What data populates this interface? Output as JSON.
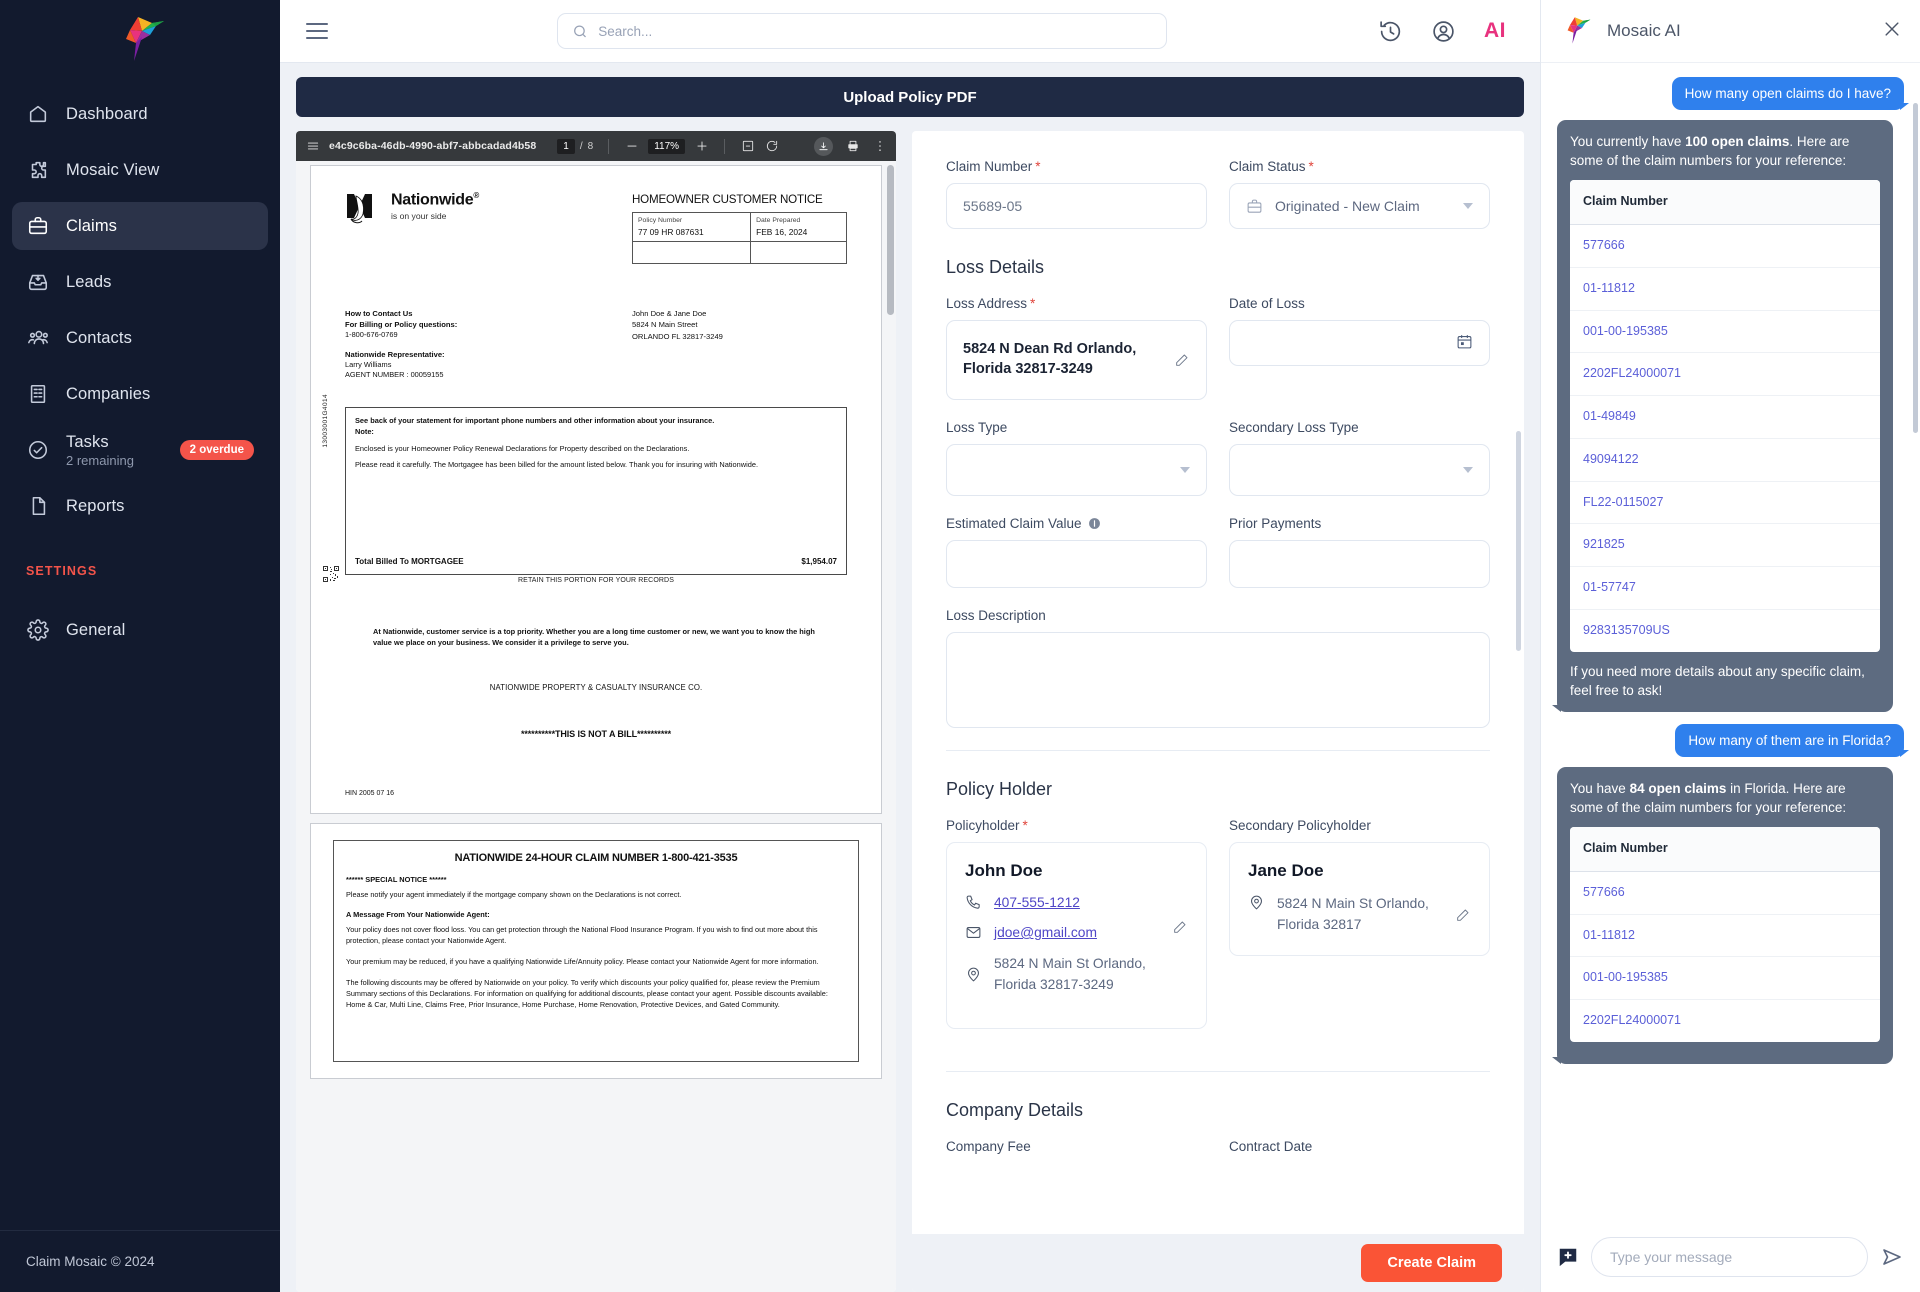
{
  "sidebar": {
    "items": [
      {
        "label": "Dashboard",
        "icon": "home-icon"
      },
      {
        "label": "Mosaic View",
        "icon": "puzzle-icon"
      },
      {
        "label": "Claims",
        "icon": "briefcase-icon",
        "active": true
      },
      {
        "label": "Leads",
        "icon": "inbox-download-icon"
      },
      {
        "label": "Contacts",
        "icon": "users-icon"
      },
      {
        "label": "Companies",
        "icon": "building-icon"
      },
      {
        "label": "Tasks",
        "sub": "2 remaining",
        "badge": "2 overdue",
        "icon": "check-circle-icon"
      },
      {
        "label": "Reports",
        "icon": "document-icon"
      }
    ],
    "settings_heading": "SETTINGS",
    "settings_items": [
      {
        "label": "General",
        "icon": "gear-icon"
      }
    ],
    "footer": "Claim Mosaic © 2024"
  },
  "topbar": {
    "search_placeholder": "Search...",
    "ai_label": "AI",
    "icons": [
      "history-icon",
      "user-circle-icon"
    ]
  },
  "upload_bar": {
    "label": "Upload Policy PDF"
  },
  "pdf": {
    "filename": "e4c9c6ba-46db-4990-abf7-abbcadad4b58",
    "page_current": "1",
    "page_total": "8",
    "zoom": "117%",
    "page1": {
      "brand_name": "Nationwide",
      "brand_reg": "®",
      "brand_tagline": "is on your side",
      "notice_title": "HOMEOWNER CUSTOMER NOTICE",
      "policy_label": "Policy Number",
      "policy_value": "77 09 HR 087631",
      "date_label": "Date Prepared",
      "date_value": "FEB 16, 2024",
      "contact_h1": "How to Contact Us",
      "contact_h2": "For Billing or Policy questions:",
      "contact_phone": "1-800-676-0769",
      "rep_label": "Nationwide Representative:",
      "rep_name": "Larry Williams",
      "rep_number": "AGENT NUMBER : 00059155",
      "addressee": "John Doe & Jane Doe",
      "address_line": "5824 N Main Street",
      "address_city": "ORLANDO FL 32817-3249",
      "note_header": "See back of your statement for important phone numbers and other information about your insurance.",
      "note_label": "Note:",
      "note_p1": "Enclosed is your Homeowner Policy Renewal Declarations for Property described on the Declarations.",
      "note_p2": "Please read it carefully. The Mortgagee has been billed for the amount listed below. Thank you for insuring with Nationwide.",
      "total_label": "Total Billed To MORTGAGEE",
      "total_value": "$1,954.07",
      "retain": "RETAIN THIS PORTION FOR YOUR RECORDS",
      "service_para": "At Nationwide, customer service is a top priority. Whether you are a long time customer or new, we want you to know the high value we place on your business. We consider it a privilege to serve you.",
      "company_line": "NATIONWIDE PROPERTY & CASUALTY INSURANCE CO.",
      "not_a_bill": "**********THIS IS NOT A BILL**********",
      "hin": "HIN 2005 07 16",
      "vertical_code": "13003001G4014"
    },
    "page2": {
      "title": "NATIONWIDE 24-HOUR CLAIM NUMBER 1-800-421-3535",
      "special_notice_h": "****** SPECIAL NOTICE ******",
      "special_notice_p": "Please notify your agent immediately if the mortgage company shown on the Declarations is not correct.",
      "agent_msg_h": "A Message From Your Nationwide Agent:",
      "agent_p1": "Your policy does not cover flood loss. You can get protection through the National Flood Insurance Program. If you wish to find out more about this protection, please contact your Nationwide Agent.",
      "agent_p2": "Your premium may be reduced, if you have a qualifying Nationwide Life/Annuity policy. Please contact your Nationwide Agent for more information.",
      "agent_p3": "The following discounts may be offered by Nationwide on your policy. To verify which discounts your policy qualified for, please review the Premium Summary sections of this Declarations. For information on qualifying for additional discounts, please contact your agent. Possible discounts available: Home & Car, Multi Line, Claims Free, Prior Insurance, Home Purchase, Home Renovation, Protective Devices, and Gated Community."
    }
  },
  "form": {
    "claim_number_label": "Claim Number",
    "claim_number_value": "55689-05",
    "claim_status_label": "Claim Status",
    "claim_status_value": "Originated - New Claim",
    "loss_details_title": "Loss Details",
    "loss_address_label": "Loss Address",
    "loss_address_value": "5824 N Dean Rd Orlando, Florida 32817-3249",
    "date_of_loss_label": "Date of Loss",
    "date_of_loss_value": "",
    "loss_type_label": "Loss Type",
    "loss_type_value": "",
    "secondary_loss_type_label": "Secondary Loss Type",
    "secondary_loss_type_value": "",
    "estimated_claim_value_label": "Estimated Claim Value",
    "estimated_claim_value": "",
    "prior_payments_label": "Prior Payments",
    "prior_payments_value": "",
    "loss_description_label": "Loss Description",
    "loss_description_value": "",
    "policy_holder_title": "Policy Holder",
    "policyholder_label": "Policyholder",
    "policyholder_name": "John Doe",
    "policyholder_phone": "407-555-1212",
    "policyholder_email": "jdoe@gmail.com",
    "policyholder_address": "5824 N Main St Orlando, Florida 32817-3249",
    "secondary_policyholder_label": "Secondary Policyholder",
    "secondary_name": "Jane Doe",
    "secondary_address": "5824 N Main St Orlando, Florida 32817",
    "company_details_title": "Company Details",
    "company_fee_label": "Company Fee",
    "contract_date_label": "Contract Date",
    "create_button": "Create Claim"
  },
  "chat": {
    "title": "Mosaic AI",
    "input_placeholder": "Type your message",
    "messages": [
      {
        "role": "user",
        "text": "How many open claims do I have?"
      },
      {
        "role": "bot",
        "text_pre": "You currently have ",
        "text_bold": "100 open claims",
        "text_post": ". Here are some of the claim numbers for your reference:",
        "table_header": "Claim Number",
        "claims": [
          "577666",
          "01-11812",
          "001-00-195385",
          "2202FL24000071",
          "01-49849",
          "49094122",
          "FL22-0115027",
          "921825",
          "01-57747",
          "9283135709US"
        ],
        "footer": "If you need more details about any specific claim, feel free to ask!"
      },
      {
        "role": "user",
        "text": "How many of them are in Florida?"
      },
      {
        "role": "bot",
        "text_pre": "You have ",
        "text_bold": "84 open claims",
        "text_post": " in Florida. Here are some of the claim numbers for your reference:",
        "table_header": "Claim Number",
        "claims": [
          "577666",
          "01-11812",
          "001-00-195385",
          "2202FL24000071"
        ]
      }
    ]
  },
  "colors": {
    "sidebar_bg": "#121a2e",
    "accent_orange": "#fa5436",
    "accent_pink": "#e8327e",
    "user_bubble": "#2f80ed",
    "bot_bubble": "#5d6b80",
    "link": "#5b5fd8"
  }
}
